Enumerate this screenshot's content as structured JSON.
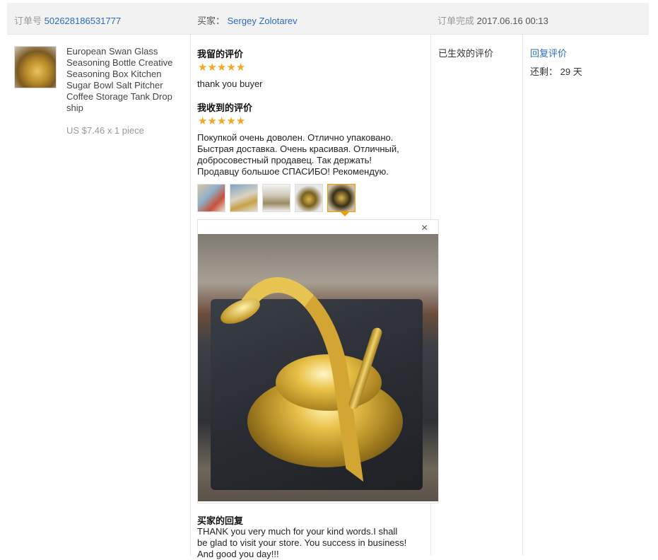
{
  "header": {
    "order_label": "订单号",
    "order_number": "502628186531777",
    "buyer_label": "买家：",
    "buyer_name": "Sergey Zolotarev",
    "completed_label": "订单完成",
    "completed_time": "2017.06.16 00:13"
  },
  "product": {
    "title": "European Swan Glass Seasoning Bottle Creative Seasoning Box Kitchen Sugar Bowl Salt Pitcher Coffee Storage Tank Drop ship",
    "price": "US $7.46 x 1 piece"
  },
  "feedback": {
    "my_review_label": "我留的评价",
    "my_stars": "★★★★★",
    "my_review_text": "thank you buyer",
    "received_label": "我收到的评价",
    "received_stars": "★★★★★",
    "received_text_lines": [
      "Покупкой очень доволен. Отлично упаковано.",
      "Быстрая доставка. Очень красивая. Отличный,",
      "добросовестный продавец. Так держать!",
      "Продавцу большое СПАСИБО! Рекомендую."
    ],
    "close_symbol": "×",
    "buyer_reply_label": "买家的回复",
    "buyer_reply_lines": [
      "THANK you very much for your kind words.I shall",
      "be glad to visit your store. You success in business!",
      "And good you day!!!"
    ]
  },
  "status": {
    "effective_label": "已生效的评价"
  },
  "actions": {
    "reply_link": "回复评价",
    "remaining_label": "还剩：",
    "remaining_value": "29 天"
  },
  "colors": {
    "link": "#2a6bbd",
    "star": "#f5a623",
    "active_thumb": "#f0a000"
  }
}
